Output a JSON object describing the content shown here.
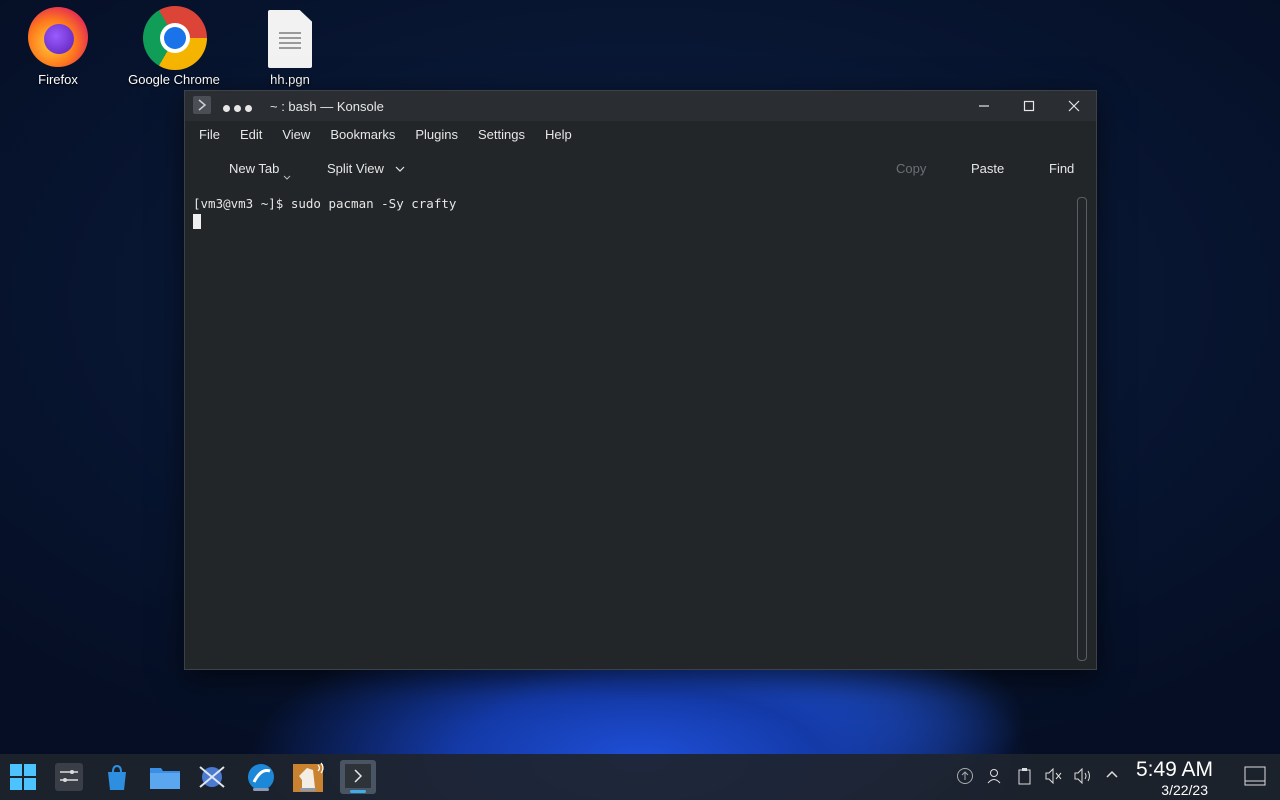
{
  "desktop": {
    "icons": [
      {
        "label": "Firefox"
      },
      {
        "label": "Google Chrome"
      },
      {
        "label": "hh.pgn"
      }
    ]
  },
  "window": {
    "title": "~ : bash — Konsole",
    "menu": [
      "File",
      "Edit",
      "View",
      "Bookmarks",
      "Plugins",
      "Settings",
      "Help"
    ],
    "toolbar": {
      "new_tab": "New Tab",
      "split_view": "Split View",
      "copy": "Copy",
      "paste": "Paste",
      "find": "Find"
    },
    "terminal": {
      "line1": "[vm3@vm3 ~]$ sudo pacman -Sy crafty"
    }
  },
  "taskbar": {
    "time": "5:49 AM",
    "date": "3/22/23",
    "apps": [
      "start-menu",
      "settings",
      "discover-store",
      "file-manager",
      "network-tool",
      "browser",
      "chess-app",
      "konsole"
    ]
  },
  "colors": {
    "terminal_bg": "#232629",
    "accent": "#3daee9"
  }
}
